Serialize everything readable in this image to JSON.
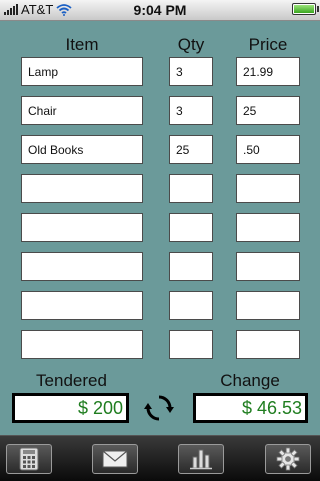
{
  "status_bar": {
    "carrier": "AT&T",
    "time": "9:04 PM",
    "signal_icon": "signal-bars-icon",
    "wifi_icon": "wifi-icon",
    "battery_icon": "battery-icon"
  },
  "headers": {
    "item": "Item",
    "qty": "Qty",
    "price": "Price"
  },
  "rows": [
    {
      "item": "Lamp",
      "qty": "3",
      "price": "21.99"
    },
    {
      "item": "Chair",
      "qty": "3",
      "price": "25"
    },
    {
      "item": "Old Books",
      "qty": "25",
      "price": ".50"
    },
    {
      "item": "",
      "qty": "",
      "price": ""
    },
    {
      "item": "",
      "qty": "",
      "price": ""
    },
    {
      "item": "",
      "qty": "",
      "price": ""
    },
    {
      "item": "",
      "qty": "",
      "price": ""
    },
    {
      "item": "",
      "qty": "",
      "price": ""
    }
  ],
  "totals": {
    "tendered_label": "Tendered",
    "tendered_value": "$ 200",
    "change_label": "Change",
    "change_value": "$ 46.53",
    "refresh_icon": "refresh-icon"
  },
  "tab_bar": {
    "tabs": [
      {
        "icon": "calculator-icon"
      },
      {
        "icon": "mail-icon"
      },
      {
        "icon": "bar-chart-icon"
      },
      {
        "icon": "gear-icon"
      }
    ]
  },
  "colors": {
    "background": "#6b9a9a",
    "money_text": "#1f7d1f"
  }
}
